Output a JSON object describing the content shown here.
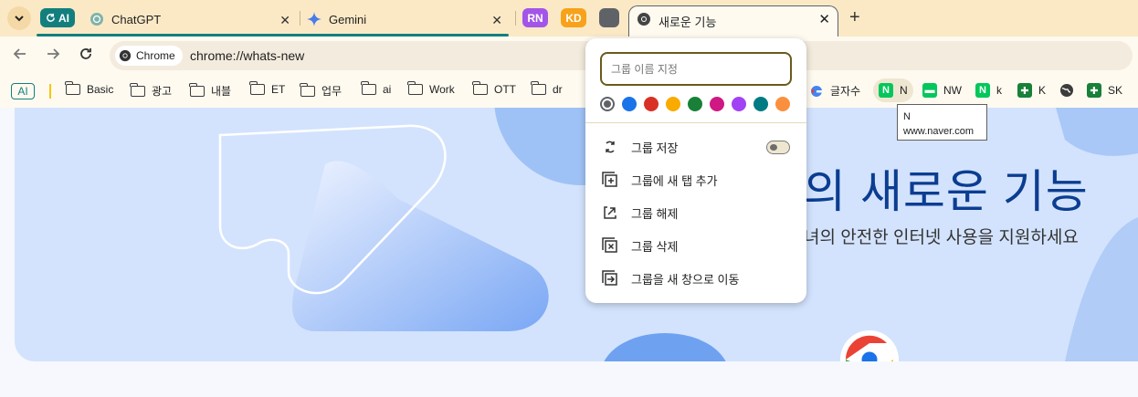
{
  "tabstrip": {
    "group_ai_label": "AI",
    "tabs": [
      {
        "title": "ChatGPT"
      },
      {
        "title": "Gemini"
      }
    ],
    "group_rn_label": "RN",
    "group_kd_label": "KD",
    "active_tab_title": "새로운 기능"
  },
  "toolbar": {
    "chip_label": "Chrome",
    "url": "chrome://whats-new"
  },
  "bookmarks": {
    "ai_label": "AI",
    "items": [
      {
        "label": "Basic"
      },
      {
        "label": "광고"
      },
      {
        "label": "내블"
      },
      {
        "label": "ET"
      },
      {
        "label": "업무"
      },
      {
        "label": "ai"
      },
      {
        "label": "Work"
      },
      {
        "label": "OTT"
      },
      {
        "label": "dr"
      },
      {
        "label": "글자수"
      },
      {
        "label": "N"
      },
      {
        "label": "NW"
      },
      {
        "label": "k"
      },
      {
        "label": "K"
      },
      {
        "label": "SK"
      }
    ]
  },
  "tooltip": {
    "title": "N",
    "url": "www.naver.com"
  },
  "hero": {
    "title": "의 새로운 기능",
    "subtitle": "녀의 안전한 인터넷 사용을 지원하세요"
  },
  "menu": {
    "name_placeholder": "그룹 이름 지정",
    "colors": [
      "#5f6368",
      "#1a73e8",
      "#d93025",
      "#f9ab00",
      "#188038",
      "#d01884",
      "#a142f4",
      "#007b83",
      "#fa903e"
    ],
    "items": [
      {
        "label": "그룹 저장"
      },
      {
        "label": "그룹에 새 탭 추가"
      },
      {
        "label": "그룹 해제"
      },
      {
        "label": "그룹 삭제"
      },
      {
        "label": "그룹을 새 창으로 이동"
      }
    ]
  },
  "accent_colors": {
    "group_ai": "#127f7e",
    "group_rn": "#a355e8",
    "group_kd": "#f7a21b",
    "tabstrip_bg": "#fbe9c6"
  }
}
